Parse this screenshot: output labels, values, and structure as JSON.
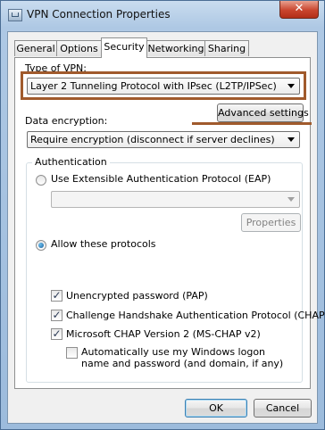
{
  "window": {
    "title": "VPN Connection Properties",
    "close_glyph": "✕"
  },
  "tabs": [
    "General",
    "Options",
    "Security",
    "Networking",
    "Sharing"
  ],
  "security": {
    "vpn_type_label": "Type of VPN:",
    "vpn_type_value": "Layer 2 Tunneling Protocol with IPsec (L2TP/IPSec)",
    "advanced_settings": "Advanced settings",
    "encryption_label": "Data encryption:",
    "encryption_value": "Require encryption (disconnect if server declines)",
    "auth_legend": "Authentication",
    "eap_radio": "Use Extensible Authentication Protocol (EAP)",
    "eap_combo_value": "",
    "properties_button": "Properties",
    "allow_radio": "Allow these protocols",
    "pap": "Unencrypted password (PAP)",
    "chap": "Challenge Handshake Authentication Protocol (CHAP)",
    "mschap": "Microsoft CHAP Version 2 (MS-CHAP v2)",
    "autologon": "Automatically use my Windows logon name and password (and domain, if any)"
  },
  "state": {
    "active_tab": "Security",
    "auth_mode": "Allow these protocols",
    "pap_checked": true,
    "chap_checked": true,
    "mschap_checked": true,
    "autologon_checked": false,
    "check_glyph": "✓"
  },
  "buttons": {
    "ok": "OK",
    "cancel": "Cancel"
  },
  "colors": {
    "annotation": "#a05a2c",
    "title_bar": "#aec8e4",
    "close_button": "#c9452e"
  }
}
